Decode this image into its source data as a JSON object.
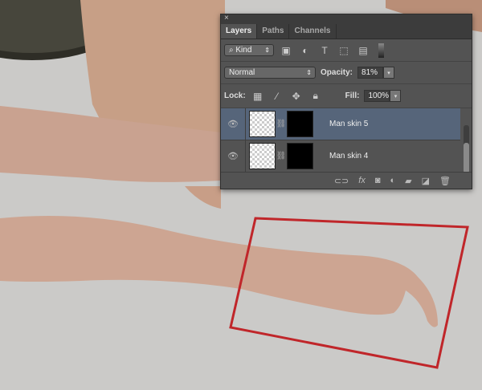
{
  "panel": {
    "close": "×",
    "tabs": [
      {
        "label": "Layers"
      },
      {
        "label": "Paths"
      },
      {
        "label": "Channels"
      }
    ],
    "filter": {
      "label": "Kind",
      "icon": "search-icon"
    },
    "blend_mode": "Normal",
    "opacity_label": "Opacity:",
    "opacity": "81%",
    "lock_label": "Lock:",
    "fill_label": "Fill:",
    "fill": "100%",
    "layers": [
      {
        "name": "Man skin 5",
        "selected": true
      },
      {
        "name": "Man skin 4",
        "selected": false
      }
    ]
  },
  "colors": {
    "selection": "#56657a",
    "red_frame": "#c0262a"
  }
}
